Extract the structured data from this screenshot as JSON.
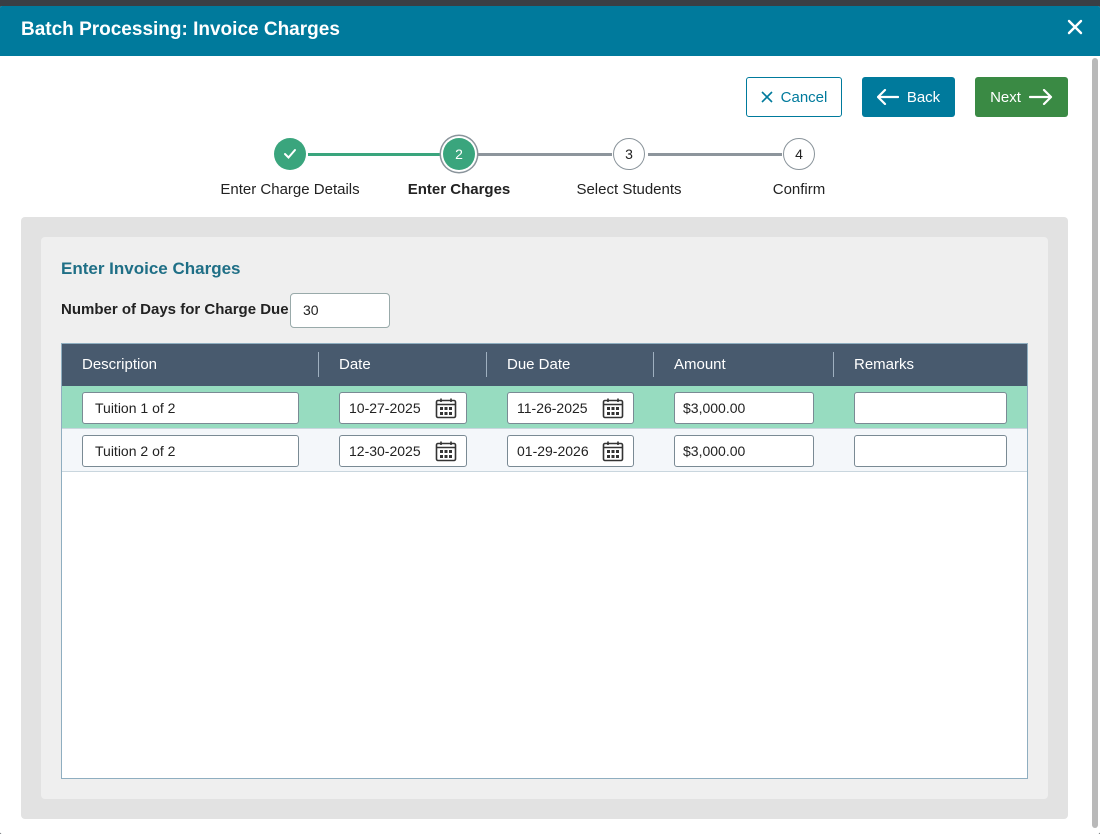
{
  "dialog": {
    "title": "Batch Processing: Invoice Charges"
  },
  "actions": {
    "cancel_label": "Cancel",
    "back_label": "Back",
    "next_label": "Next"
  },
  "stepper": {
    "steps": [
      {
        "number": "1",
        "label": "Enter Charge Details",
        "status": "complete"
      },
      {
        "number": "2",
        "label": "Enter Charges",
        "status": "current"
      },
      {
        "number": "3",
        "label": "Select Students",
        "status": "upcoming"
      },
      {
        "number": "4",
        "label": "Confirm",
        "status": "upcoming"
      }
    ]
  },
  "form": {
    "section_title": "Enter Invoice Charges",
    "days_label": "Number of Days for Charge Due",
    "days_value": "30"
  },
  "grid": {
    "columns": [
      "Description",
      "Date",
      "Due Date",
      "Amount",
      "Remarks"
    ],
    "rows": [
      {
        "description": "Tuition 1 of 2",
        "date": "10-27-2025",
        "due_date": "11-26-2025",
        "amount": "$3,000.00",
        "remarks": ""
      },
      {
        "description": "Tuition 2 of 2",
        "date": "12-30-2025",
        "due_date": "01-29-2026",
        "amount": "$3,000.00",
        "remarks": ""
      }
    ]
  },
  "colors": {
    "header": "#007a9c",
    "complete": "#3aa57d",
    "next": "#3a8a44",
    "grid_header": "#485a6e",
    "selected_row": "#97dcc0"
  }
}
